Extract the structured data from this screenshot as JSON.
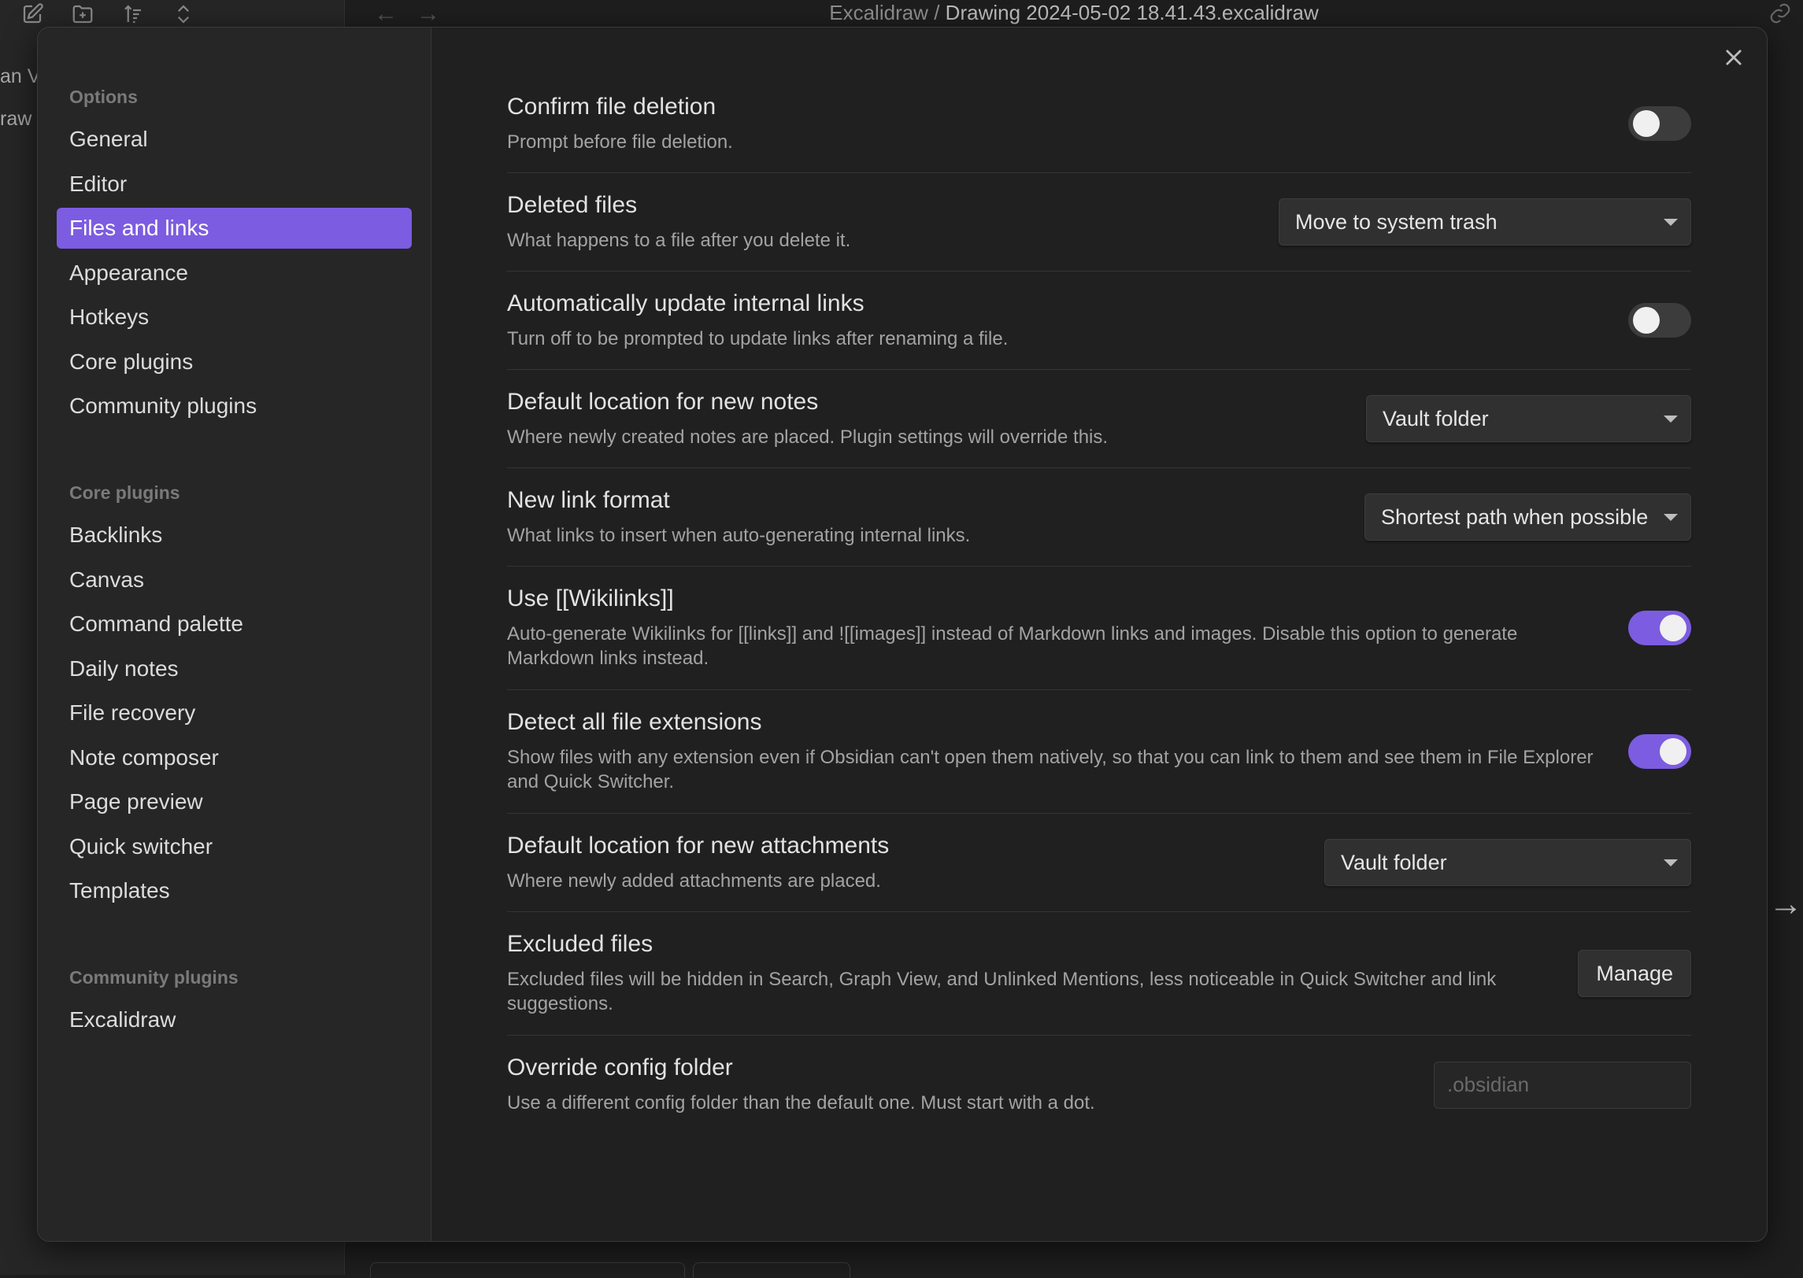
{
  "background": {
    "breadcrumb_parent": "Excalidraw",
    "breadcrumb_sep": "/",
    "breadcrumb_current": "Drawing 2024-05-02 18.41.43.excalidraw",
    "left_peek": [
      "an Va",
      "raw"
    ]
  },
  "sidebar": {
    "options_header": "Options",
    "options": [
      "General",
      "Editor",
      "Files and links",
      "Appearance",
      "Hotkeys",
      "Core plugins",
      "Community plugins"
    ],
    "active": "Files and links",
    "core_header": "Core plugins",
    "core": [
      "Backlinks",
      "Canvas",
      "Command palette",
      "Daily notes",
      "File recovery",
      "Note composer",
      "Page preview",
      "Quick switcher",
      "Templates"
    ],
    "community_header": "Community plugins",
    "community": [
      "Excalidraw"
    ]
  },
  "settings": {
    "confirm_deletion": {
      "name": "Confirm file deletion",
      "desc": "Prompt before file deletion.",
      "enabled": false
    },
    "deleted_files": {
      "name": "Deleted files",
      "desc": "What happens to a file after you delete it.",
      "value": "Move to system trash"
    },
    "auto_update_links": {
      "name": "Automatically update internal links",
      "desc": "Turn off to be prompted to update links after renaming a file.",
      "enabled": false
    },
    "default_location_notes": {
      "name": "Default location for new notes",
      "desc": "Where newly created notes are placed. Plugin settings will override this.",
      "value": "Vault folder"
    },
    "new_link_format": {
      "name": "New link format",
      "desc": "What links to insert when auto-generating internal links.",
      "value": "Shortest path when possible"
    },
    "use_wikilinks": {
      "name": "Use [[Wikilinks]]",
      "desc": "Auto-generate Wikilinks for [[links]] and ![[images]] instead of Markdown links and images. Disable this option to generate Markdown links instead.",
      "enabled": true
    },
    "detect_extensions": {
      "name": "Detect all file extensions",
      "desc": "Show files with any extension even if Obsidian can't open them natively, so that you can link to them and see them in File Explorer and Quick Switcher.",
      "enabled": true
    },
    "default_location_attachments": {
      "name": "Default location for new attachments",
      "desc": "Where newly added attachments are placed.",
      "value": "Vault folder"
    },
    "excluded_files": {
      "name": "Excluded files",
      "desc": "Excluded files will be hidden in Search, Graph View, and Unlinked Mentions, less noticeable in Quick Switcher and link suggestions.",
      "button": "Manage"
    },
    "override_config": {
      "name": "Override config folder",
      "desc": "Use a different config folder than the default one. Must start with a dot.",
      "placeholder": ".obsidian",
      "value": ""
    }
  },
  "colors": {
    "accent": "#7c5ce0",
    "background": "#1e1e1e",
    "modal": "#202020",
    "sidebar": "#262626"
  }
}
